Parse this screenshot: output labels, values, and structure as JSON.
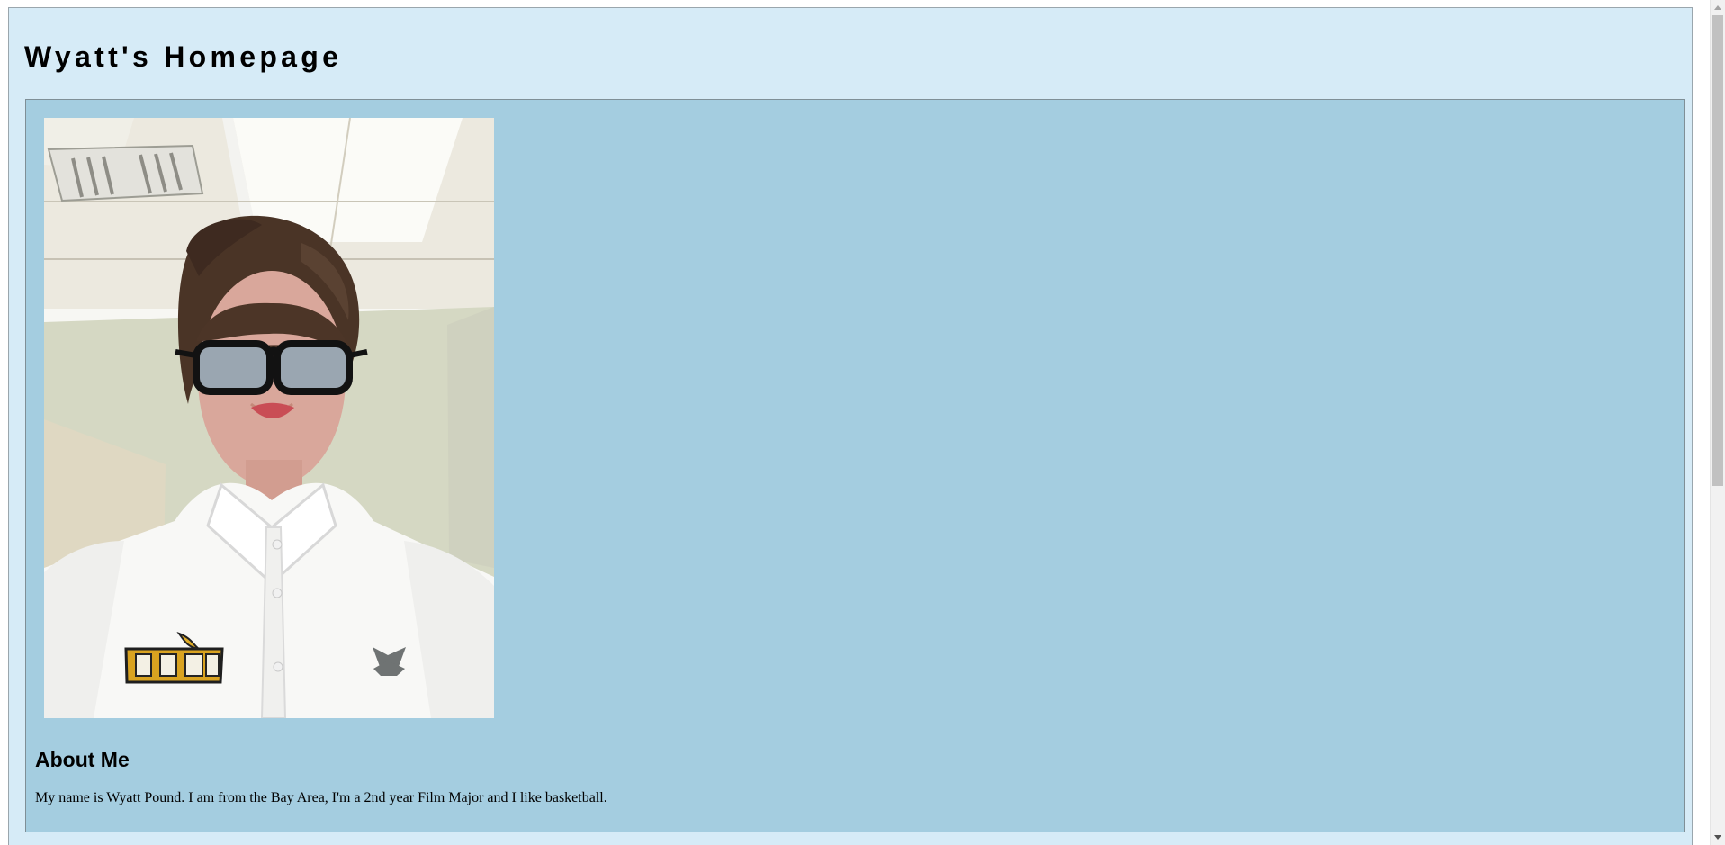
{
  "page": {
    "title": "Wyatt's Homepage",
    "background_color": "#d6ebf7",
    "panel_color": "#a4cde0"
  },
  "profile": {
    "photo_alt": "Wyatt Pound",
    "photo_colors": {
      "ceiling": "#ece9df",
      "light_panel": "#fbfbf7",
      "wall": "#d8dbc6",
      "hair": "#473324",
      "skin": "#d7a497",
      "shirt": "#f8f8f6",
      "glasses": "#111111",
      "logo_gold": "#d7a21f",
      "logo_gray": "#6f7373"
    }
  },
  "about": {
    "heading": "About Me",
    "text": "My name is Wyatt Pound. I am from the Bay Area, I'm a 2nd year Film Major and I like basketball."
  },
  "scrollbar": {
    "up_icon": "scroll-up-arrow-icon",
    "down_icon": "scroll-down-arrow-icon"
  }
}
